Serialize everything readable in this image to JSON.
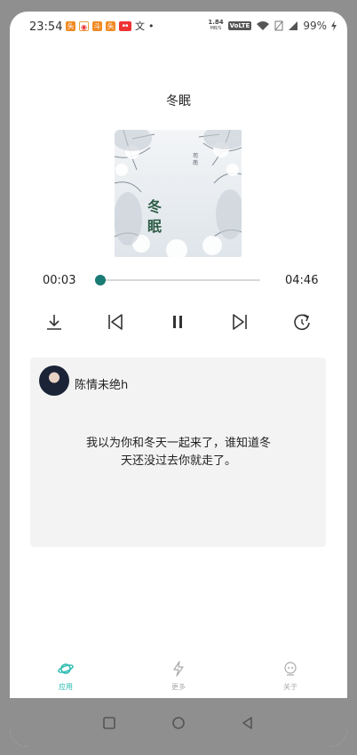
{
  "status_bar": {
    "time": "23:54",
    "network_speed_value": "1.84",
    "network_speed_unit": "MB/S",
    "network_type": "VoLTE",
    "battery": "99%",
    "notification_char": "文",
    "notification_apps": [
      "orange-app-icon",
      "weibo-icon",
      "orange-app-icon",
      "orange-app-icon",
      "red-app-icon"
    ]
  },
  "player": {
    "song_title": "冬眠",
    "cover_title": "冬眠",
    "cover_artist": "司南",
    "current_time": "00:03",
    "total_time": "04:46",
    "progress": 0.01,
    "accent_color": "#1a7a74"
  },
  "controls": [
    "download-icon",
    "previous-icon",
    "pause-icon",
    "next-icon",
    "repeat-icon"
  ],
  "comment": {
    "username": "陈情未绝h",
    "text": "我以为你和冬天一起来了，谁知道冬天还没过去你就走了。"
  },
  "tabs": [
    {
      "label": "应用",
      "icon": "planet-icon",
      "active": true
    },
    {
      "label": "更多",
      "icon": "lightning-icon",
      "active": false
    },
    {
      "label": "关于",
      "icon": "robot-icon",
      "active": false
    }
  ],
  "colors": {
    "tab_active": "#2bbbb0",
    "tab_inactive": "#aaaaaa"
  }
}
